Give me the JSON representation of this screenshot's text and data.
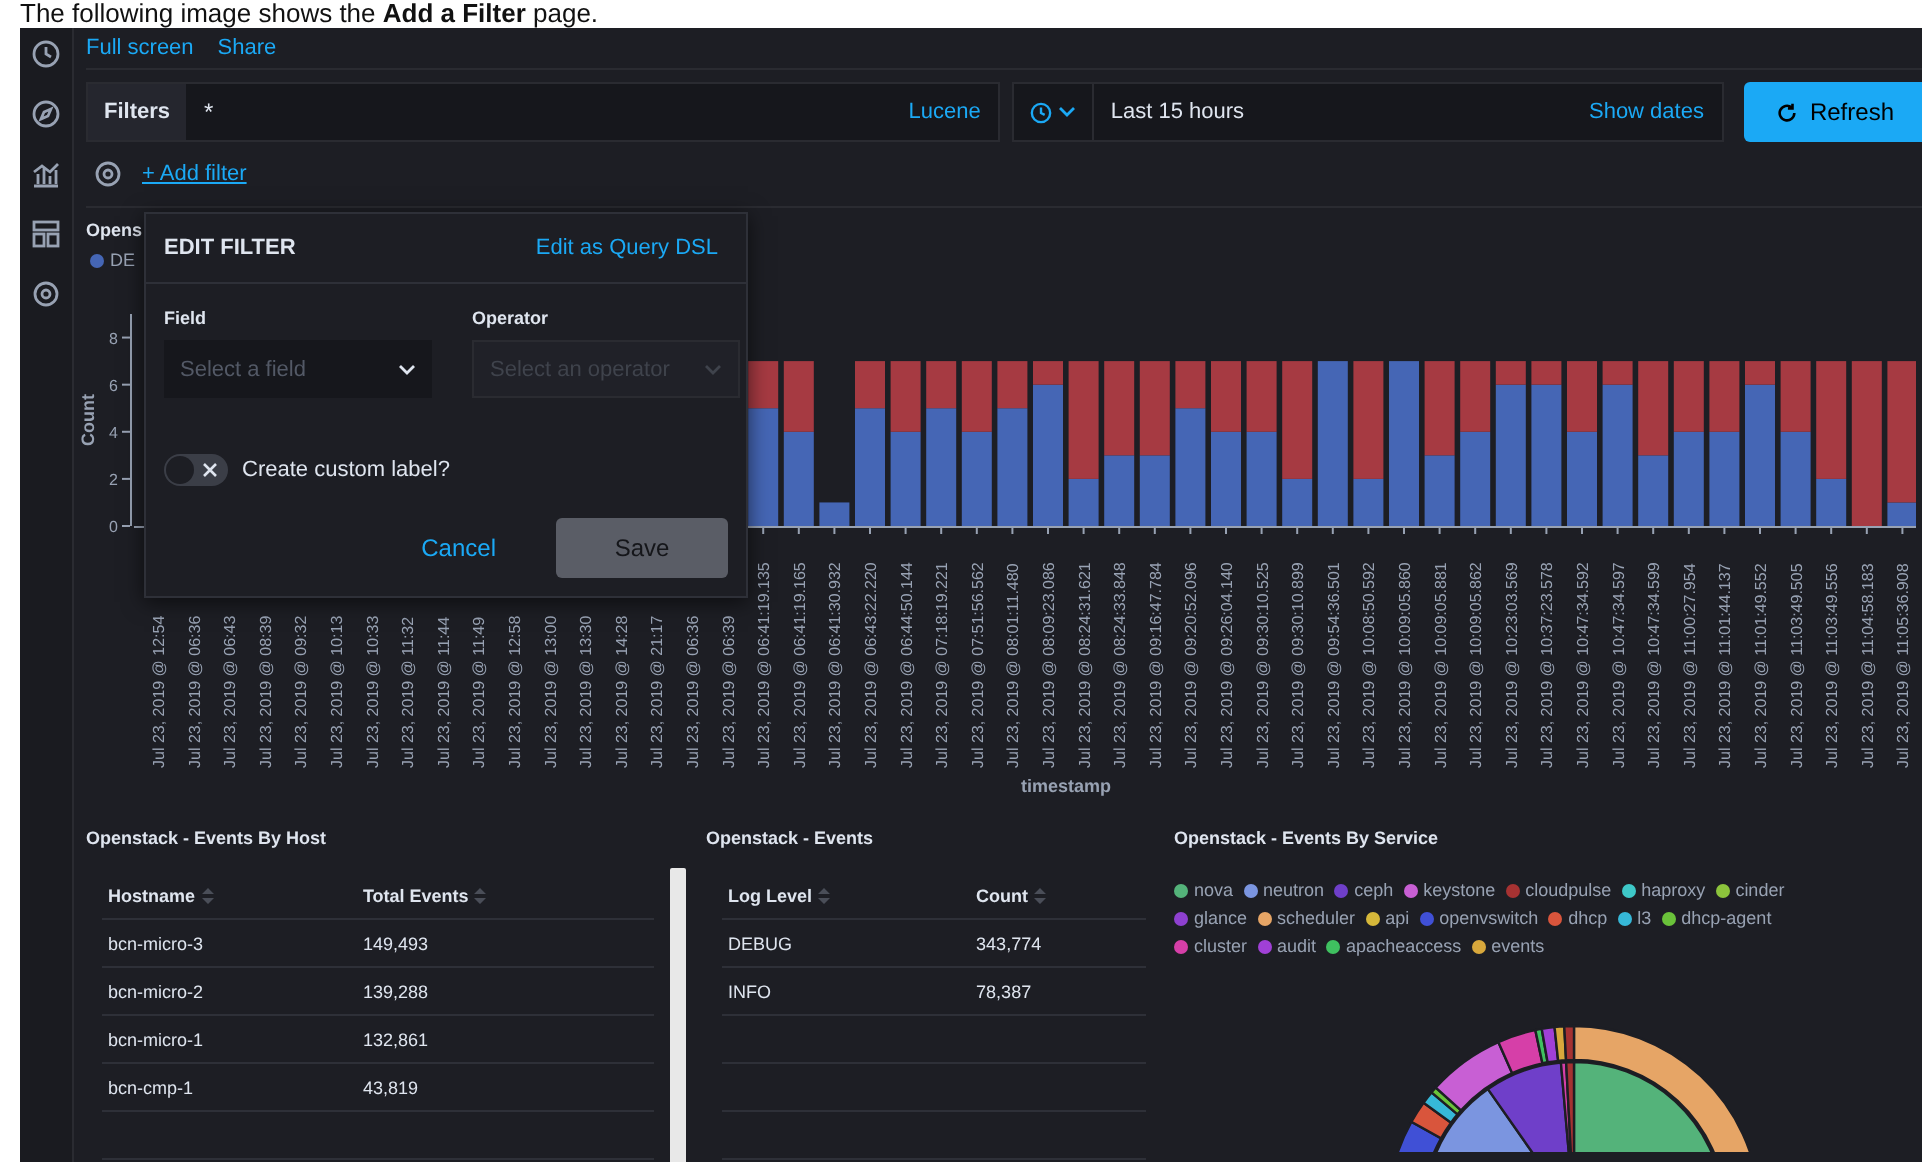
{
  "caption": "The following image shows the **Add a Filter** page.",
  "top_nav": {
    "links": [
      "Full screen",
      "Share"
    ]
  },
  "query_bar": {
    "filters_button": "Filters",
    "query": "*",
    "language": "Lucene",
    "time_range": "Last 15 hours",
    "show_dates": "Show dates",
    "refresh_button": "Refresh"
  },
  "filter_bar": {
    "add_filter": "+ Add filter"
  },
  "histogram": {
    "title": "Opens",
    "chart_data": {
      "type": "bar",
      "stacked": true,
      "xlabel": "timestamp",
      "ylabel": "Count",
      "ylim": [
        0,
        9
      ],
      "yticks": [
        0,
        2,
        4,
        6,
        8
      ],
      "categories": [
        "Jul 23, 2019 @ 12:54",
        "Jul 23, 2019 @ 06:36",
        "Jul 23, 2019 @ 06:43",
        "Jul 23, 2019 @ 08:39",
        "Jul 23, 2019 @ 09:32",
        "Jul 23, 2019 @ 10:13",
        "Jul 23, 2019 @ 10:33",
        "Jul 23, 2019 @ 11:32",
        "Jul 23, 2019 @ 11:44",
        "Jul 23, 2019 @ 11:49",
        "Jul 23, 2019 @ 12:58",
        "Jul 23, 2019 @ 13:00",
        "Jul 23, 2019 @ 13:30",
        "Jul 23, 2019 @ 14:28",
        "Jul 23, 2019 @ 21:17",
        "Jul 23, 2019 @ 06:36",
        "Jul 23, 2019 @ 06:39",
        "Jul 23, 2019 @ 06:41:19.135",
        "Jul 23, 2019 @ 06:41:19.165",
        "Jul 23, 2019 @ 06:41:30.932",
        "Jul 23, 2019 @ 06:43:22.220",
        "Jul 23, 2019 @ 06:44:50.144",
        "Jul 23, 2019 @ 07:18:19.221",
        "Jul 23, 2019 @ 07:51:56.562",
        "Jul 23, 2019 @ 08:01:11.480",
        "Jul 23, 2019 @ 08:09:23.086",
        "Jul 23, 2019 @ 08:24:31.621",
        "Jul 23, 2019 @ 08:24:33.848",
        "Jul 23, 2019 @ 09:16:47.784",
        "Jul 23, 2019 @ 09:20:52.096",
        "Jul 23, 2019 @ 09:26:04.140",
        "Jul 23, 2019 @ 09:30:10.525",
        "Jul 23, 2019 @ 09:30:10.899",
        "Jul 23, 2019 @ 09:54:36.501",
        "Jul 23, 2019 @ 10:08:50.592",
        "Jul 23, 2019 @ 10:09:05.860",
        "Jul 23, 2019 @ 10:09:05.881",
        "Jul 23, 2019 @ 10:09:05.862",
        "Jul 23, 2019 @ 10:23:03.569",
        "Jul 23, 2019 @ 10:37:23.578",
        "Jul 23, 2019 @ 10:47:34.592",
        "Jul 23, 2019 @ 10:47:34.597",
        "Jul 23, 2019 @ 10:47:34.599",
        "Jul 23, 2019 @ 11:00:27.954",
        "Jul 23, 2019 @ 11:01:44.137",
        "Jul 23, 2019 @ 11:01:49.552",
        "Jul 23, 2019 @ 11:03:49.505",
        "Jul 23, 2019 @ 11:03:49.556",
        "Jul 23, 2019 @ 11:04:58.183",
        "Jul 23, 2019 @ 11:05:36.908"
      ],
      "series": [
        {
          "name": "DE",
          "color": "#4566b5",
          "values": [
            null,
            null,
            null,
            null,
            null,
            null,
            null,
            null,
            null,
            null,
            null,
            null,
            null,
            null,
            null,
            null,
            null,
            5,
            4,
            1,
            5,
            4,
            5,
            4,
            5,
            6,
            2,
            3,
            3,
            5,
            4,
            4,
            2,
            7,
            2,
            7,
            3,
            4,
            6,
            6,
            4,
            6,
            3,
            4,
            4,
            6,
            4,
            2,
            0,
            1
          ]
        },
        {
          "color": "#a63a42",
          "values": [
            null,
            null,
            null,
            null,
            null,
            null,
            null,
            null,
            null,
            null,
            null,
            null,
            null,
            null,
            null,
            null,
            null,
            2,
            3,
            0,
            2,
            3,
            2,
            3,
            2,
            1,
            5,
            4,
            4,
            2,
            3,
            3,
            5,
            0,
            5,
            0,
            4,
            3,
            1,
            1,
            3,
            1,
            4,
            3,
            3,
            1,
            3,
            5,
            7,
            6
          ]
        }
      ]
    }
  },
  "edit_filter": {
    "title": "EDIT FILTER",
    "query_dsl_link": "Edit as Query DSL",
    "field": {
      "label": "Field",
      "placeholder": "Select a field",
      "disabled": false
    },
    "operator": {
      "label": "Operator",
      "placeholder": "Select an operator",
      "disabled": true
    },
    "custom_label": {
      "label": "Create custom label?",
      "on": false
    },
    "cancel_button": "Cancel",
    "save_button": {
      "label": "Save",
      "disabled": true
    }
  },
  "host_table": {
    "title": "Openstack - Events By Host",
    "columns": [
      "Hostname",
      "Total Events"
    ],
    "rows": [
      [
        "bcn-micro-3",
        "149,493"
      ],
      [
        "bcn-micro-2",
        "139,288"
      ],
      [
        "bcn-micro-1",
        "132,861"
      ],
      [
        "bcn-cmp-1",
        "43,819"
      ]
    ]
  },
  "events_table": {
    "title": "Openstack - Events",
    "columns": [
      "Log Level",
      "Count"
    ],
    "rows": [
      [
        "DEBUG",
        "343,774"
      ],
      [
        "INFO",
        "78,387"
      ]
    ]
  },
  "service_panel": {
    "title": "Openstack - Events By Service",
    "legend": [
      {
        "label": "nova",
        "color": "#54b37a"
      },
      {
        "label": "neutron",
        "color": "#7b95e0"
      },
      {
        "label": "ceph",
        "color": "#6f3fc9"
      },
      {
        "label": "keystone",
        "color": "#c85fd4"
      },
      {
        "label": "cloudpulse",
        "color": "#a63232"
      },
      {
        "label": "haproxy",
        "color": "#3ec8c8"
      },
      {
        "label": "cinder",
        "color": "#8cc43c"
      },
      {
        "label": "glance",
        "color": "#8e40d0"
      },
      {
        "label": "scheduler",
        "color": "#e6a566"
      },
      {
        "label": "api",
        "color": "#d6b83a"
      },
      {
        "label": "openvswitch",
        "color": "#4050d6"
      },
      {
        "label": "dhcp",
        "color": "#d9553c"
      },
      {
        "label": "l3",
        "color": "#36b8d8"
      },
      {
        "label": "dhcp-agent",
        "color": "#6ac23a"
      },
      {
        "label": "cluster",
        "color": "#d63fa8"
      },
      {
        "label": "audit",
        "color": "#a040d6"
      },
      {
        "label": "apacheaccess",
        "color": "#3fc060"
      },
      {
        "label": "events",
        "color": "#d8a83c"
      }
    ]
  }
}
